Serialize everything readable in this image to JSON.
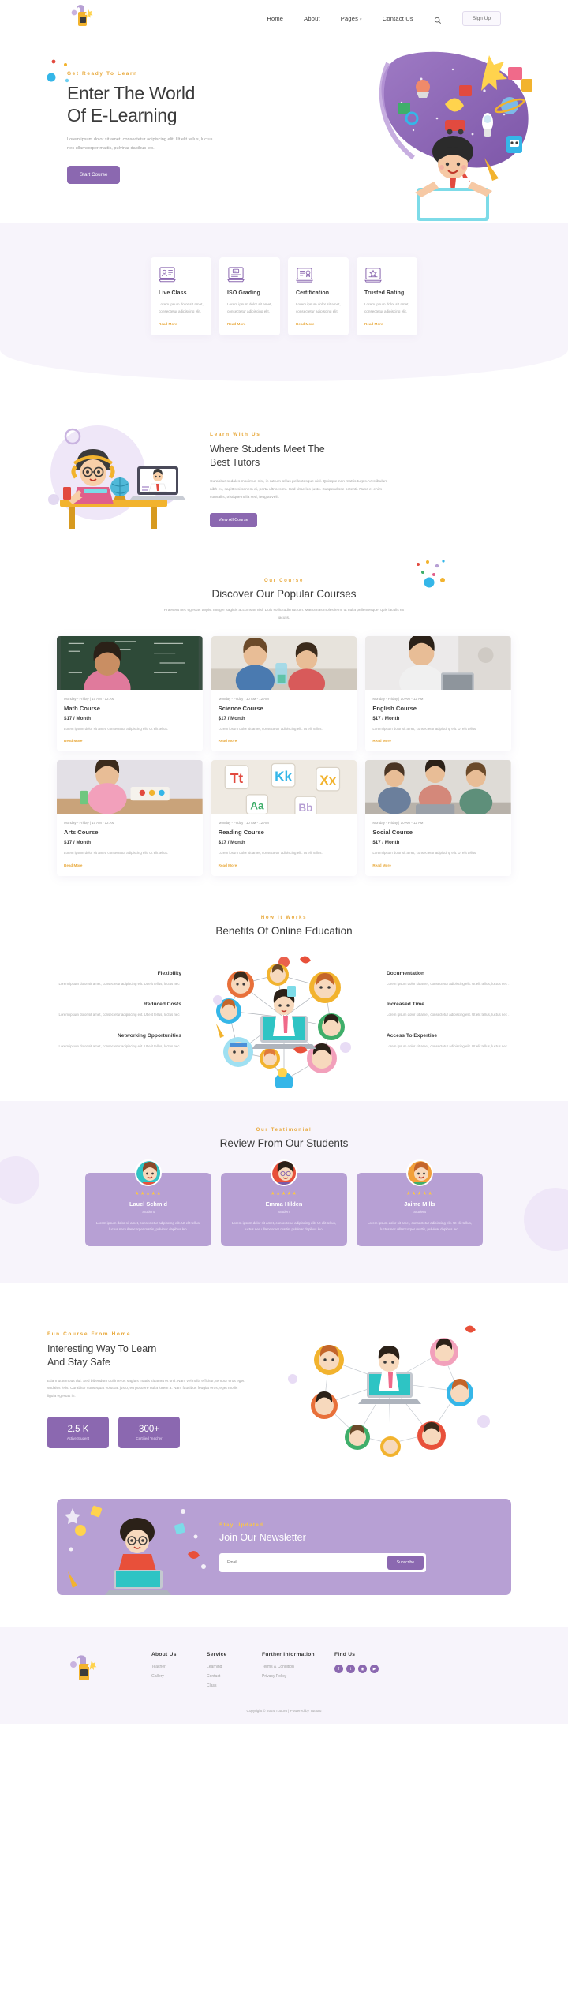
{
  "header": {
    "logo_name": "tutturu-logo",
    "nav": [
      {
        "label": "Home",
        "has_caret": false
      },
      {
        "label": "About",
        "has_caret": false
      },
      {
        "label": "Pages",
        "has_caret": true
      },
      {
        "label": "Contact Us",
        "has_caret": false
      }
    ],
    "search_icon": "search-icon",
    "signup_label": "Sign Up"
  },
  "hero": {
    "eyebrow": "Get Ready To Learn",
    "title_line1": "Enter The World",
    "title_line2": "Of E-Learning",
    "paragraph": "Lorem ipsum dolor sit amet, consectetur adipiscing elit. Ut elit tellus, luctus nec ullamcorper mattis, pulvinar dapibus leo.",
    "cta_label": "Start Course"
  },
  "features": [
    {
      "icon": "live-class-icon",
      "title": "Live Class",
      "desc": "Lorem ipsum dolor sit amet, consectetur adipiscing elit.",
      "link": "Read More"
    },
    {
      "icon": "iso-grading-icon",
      "title": "ISO Grading",
      "desc": "Lorem ipsum dolor sit amet, consectetur adipiscing elit.",
      "link": "Read More"
    },
    {
      "icon": "certification-icon",
      "title": "Certification",
      "desc": "Lorem ipsum dolor sit amet, consectetur adipiscing elit.",
      "link": "Read More"
    },
    {
      "icon": "trusted-rating-icon",
      "title": "Trusted Rating",
      "desc": "Lorem ipsum dolor sit amet, consectetur adipiscing elit.",
      "link": "Read More"
    }
  ],
  "tutors": {
    "eyebrow": "Learn With Us",
    "title_line1": "Where Students Meet The",
    "title_line2": "Best Tutors",
    "paragraph": "Curabitur sodales maximus nisl, in rutrum tellus pellentesque nisl. Quisque non mattis turpis. Vestibulum nibh ex, sagittis si sonem ei, porta ultrices mi. Sed vitae leo justo. Suspendisse potenti. Nunc et enim convallis, tristique nulla sed, feugiat velit.",
    "cta_label": "View All Course"
  },
  "courses": {
    "eyebrow": "Our Course",
    "title": "Discover Our Popular Courses",
    "subtitle": "Praesent nec egestas turpis. Integer sagittis accumsan nisl. Duis sollicitudin rutrum. Maecenas molestie mi ut nulla pellentesque, quis iaculis ex iaculis.",
    "items": [
      {
        "meta": "Monday - Friday | 10 AM - 12 AM",
        "name": "Math Course",
        "price": "$17 / Month",
        "desc": "Lorem ipsum dolor sit amet, consectetur adipiscing elit. Ut elit tellus.",
        "link": "Read More",
        "image": "girl-at-chalkboard"
      },
      {
        "meta": "Monday - Friday | 10 AM - 12 AM",
        "name": "Science Course",
        "price": "$17 / Month",
        "desc": "Lorem ipsum dolor sit amet, consectetur adipiscing elit. Ut elit tellus.",
        "link": "Read More",
        "image": "kids-with-microscope"
      },
      {
        "meta": "Monday - Friday | 10 AM - 12 AM",
        "name": "English Course",
        "price": "$17 / Month",
        "desc": "Lorem ipsum dolor sit amet, consectetur adipiscing elit. Ut elit tellus.",
        "link": "Read More",
        "image": "girl-with-laptop"
      },
      {
        "meta": "Monday - Friday | 10 AM - 12 AM",
        "name": "Arts Course",
        "price": "$17 / Month",
        "desc": "Lorem ipsum dolor sit amet, consectetur adipiscing elit. Ut elit tellus.",
        "link": "Read More",
        "image": "girl-painting"
      },
      {
        "meta": "Monday - Friday | 10 AM - 12 AM",
        "name": "Reading Course",
        "price": "$17 / Month",
        "desc": "Lorem ipsum dolor sit amet, consectetur adipiscing elit. Ut elit tellus.",
        "link": "Read More",
        "image": "alphabet-letters"
      },
      {
        "meta": "Monday - Friday | 10 AM - 12 AM",
        "name": "Social Course",
        "price": "$17 / Month",
        "desc": "Lorem ipsum dolor sit amet, consectetur adipiscing elit. Ut elit tellus.",
        "link": "Read More",
        "image": "students-group-laptop"
      }
    ]
  },
  "benefits": {
    "eyebrow": "How It Works",
    "title": "Benefits Of Online Education",
    "left": [
      {
        "title": "Flexibility",
        "desc": "Lorem ipsum dolor sit amet, consectetur adipiscing elit. Ut elit tellus, luctus nec ."
      },
      {
        "title": "Reduced Costs",
        "desc": "Lorem ipsum dolor sit amet, consectetur adipiscing elit. Ut elit tellus, luctus nec ."
      },
      {
        "title": "Networking Opportunities",
        "desc": "Lorem ipsum dolor sit amet, consectetur adipiscing elit. Ut elit tellus, luctus nec ."
      }
    ],
    "right": [
      {
        "title": "Documentation",
        "desc": "Lorem ipsum dolor sit amet, consectetur adipiscing elit. Ut elit tellus, luctus nec ."
      },
      {
        "title": "Increased Time",
        "desc": "Lorem ipsum dolor sit amet, consectetur adipiscing elit. Ut elit tellus, luctus nec ."
      },
      {
        "title": "Access To Expertise",
        "desc": "Lorem ipsum dolor sit amet, consectetur adipiscing elit. Ut elit tellus, luctus nec ."
      }
    ]
  },
  "testimonials": {
    "eyebrow": "Our Testimonial",
    "title": "Review From Our Students",
    "items": [
      {
        "stars": "★★★★★",
        "name": "Lauel Schmid",
        "role": "Student",
        "text": "Lorem ipsum dolor sit amet, consectetur adipiscing elit. Ut elit tellus, luctus nec ullamcorper mattis, pulvinar dapibus leo.",
        "avatar": "boy-avatar"
      },
      {
        "stars": "★★★★★",
        "name": "Emma Hilden",
        "role": "Student",
        "text": "Lorem ipsum dolor sit amet, consectetur adipiscing elit. Ut elit tellus, luctus nec ullamcorper mattis, pulvinar dapibus leo.",
        "avatar": "girl-glasses-avatar"
      },
      {
        "stars": "★★★★★",
        "name": "Jaime Mills",
        "role": "Student",
        "text": "Lorem ipsum dolor sit amet, consectetur adipiscing elit. Ut elit tellus, luctus nec ullamcorper mattis, pulvinar dapibus leo.",
        "avatar": "boy-orange-avatar"
      }
    ]
  },
  "safe": {
    "eyebrow": "Fun Course From Home",
    "title_line1": "Interesting Way To Learn",
    "title_line2": "And Stay Safe",
    "paragraph": "Etiam ut tempus dui. Sed bibendum dui in eros sagittis mattis sit amet et orci. Nam vel nulla efficitur, tempor eros eget sodales felis. Curabitur consequat volutpat justo, eu posuere nulla lorem a. Nam faucibus feugiat eros, eget mollis ligula egestas in.",
    "stats": [
      {
        "number": "2.5 K",
        "label": "Active Student"
      },
      {
        "number": "300+",
        "label": "Certified Teacher"
      }
    ]
  },
  "newsletter": {
    "eyebrow": "Stay Updated",
    "title": "Join Our Newsletter",
    "placeholder": "Email",
    "button": "Subscribe"
  },
  "footer": {
    "logo_name": "tutturu-footer-logo",
    "columns": [
      {
        "heading": "About Us",
        "links": [
          "Teacher",
          "Gallery"
        ]
      },
      {
        "heading": "Service",
        "links": [
          "Learning",
          "Contact",
          "Class"
        ]
      },
      {
        "heading": "Further Information",
        "links": [
          "Terms & Condition",
          "Privacy Policy"
        ]
      }
    ],
    "find_us_heading": "Find Us",
    "socials": [
      "facebook-icon",
      "twitter-icon",
      "instagram-icon",
      "youtube-icon"
    ],
    "copyright": "Copyright © 2024 Tutturu | Powered by Tutturu"
  },
  "colors": {
    "accent_purple": "#8b68b0",
    "light_purple": "#b7a0d4",
    "gold": "#e8a83a",
    "band_bg": "#f7f4fb"
  }
}
